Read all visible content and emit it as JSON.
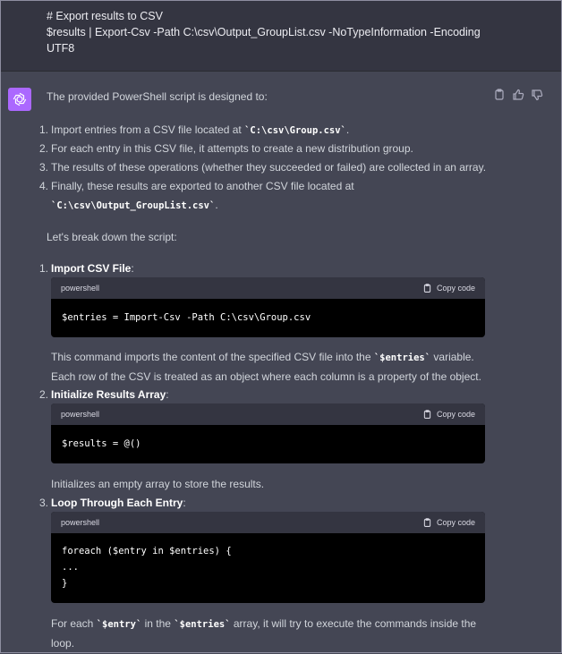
{
  "user": {
    "line1": "# Export results to CSV",
    "line2": "$results | Export-Csv -Path C:\\csv\\Output_GroupList.csv -NoTypeInformation -Encoding",
    "line3": "UTF8"
  },
  "assistant": {
    "intro": "The provided PowerShell script is designed to:",
    "list": [
      {
        "n": "1.",
        "pre": "Import entries from a CSV file located at ",
        "code": "`C:\\csv\\Group.csv`",
        "post": "."
      },
      {
        "n": "2.",
        "text": "For each entry in this CSV file, it attempts to create a new distribution group."
      },
      {
        "n": "3.",
        "text": "The results of these operations (whether they succeeded or failed) are collected in an array."
      },
      {
        "n": "4.",
        "pre": "Finally, these results are exported to another CSV file located at",
        "code": "`C:\\csv\\Output_GroupList.csv`",
        "post": "."
      }
    ],
    "breakdown": "Let's break down the script:",
    "steps": [
      {
        "n": "1.",
        "title": "Import CSV File",
        "lang": "powershell",
        "copy": "Copy code",
        "code": "$entries = Import-Csv -Path C:\\csv\\Group.csv",
        "desc_pre": "This command imports the content of the specified CSV file into the ",
        "desc_code": "`$entries`",
        "desc_post": " variable.",
        "desc_line2": "Each row of the CSV is treated as an object where each column is a property of the object."
      },
      {
        "n": "2.",
        "title": "Initialize Results Array",
        "lang": "powershell",
        "copy": "Copy code",
        "code": "$results = @()",
        "desc": "Initializes an empty array to store the results."
      },
      {
        "n": "3.",
        "title": "Loop Through Each Entry",
        "lang": "powershell",
        "copy": "Copy code",
        "code1": "foreach ($entry in $entries) {",
        "code2": "...",
        "code3": "}",
        "desc_pre": "For each ",
        "desc_code1": "`$entry`",
        "desc_mid": " in the ",
        "desc_code2": "`$entries`",
        "desc_post": " array, it will try to execute the commands inside the",
        "desc_line2": "loop."
      }
    ]
  },
  "icons": {
    "avatar": "openai-logo-icon",
    "copy": "clipboard-icon",
    "up": "thumbs-up-icon",
    "down": "thumbs-down-icon"
  },
  "colors": {
    "avatar": "#ab68ff",
    "user_bg": "#343541",
    "assistant_bg": "#444654",
    "code_bg": "#000000"
  }
}
